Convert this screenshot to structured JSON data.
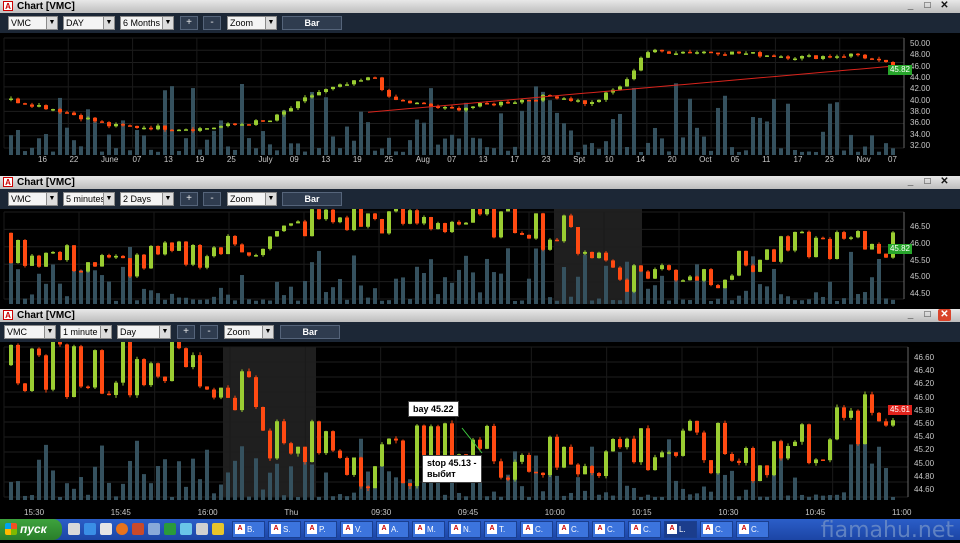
{
  "windows": [
    {
      "title": "Chart [VMC]",
      "symbol": "VMC",
      "interval": "DAY",
      "range": "6 Months",
      "tool": "Zoom",
      "plus": "+",
      "minus": "-",
      "bar_label": "Bar",
      "y_labels": [
        "50.00",
        "48.00",
        "46.00",
        "44.00",
        "42.00",
        "40.00",
        "38.00",
        "36.00",
        "34.00",
        "32.00"
      ],
      "x_labels": [
        "16",
        "22",
        "June",
        "07",
        "13",
        "19",
        "25",
        "July",
        "09",
        "13",
        "19",
        "25",
        "Aug",
        "07",
        "13",
        "17",
        "23",
        "Spt",
        "10",
        "14",
        "20",
        "Oct",
        "05",
        "11",
        "17",
        "23",
        "Nov",
        "07"
      ],
      "last_price": "45.82",
      "last_color": "#27a52b"
    },
    {
      "title": "Chart [VMC]",
      "symbol": "VMC",
      "interval": "5 minutes",
      "range": "2 Days",
      "tool": "Zoom",
      "plus": "+",
      "minus": "-",
      "bar_label": "Bar",
      "y_labels": [
        "46.50",
        "46.00",
        "45.50",
        "45.00",
        "44.50"
      ],
      "last_price": "45.82",
      "last_color": "#27a52b"
    },
    {
      "title": "Chart [VMC]",
      "symbol": "VMC",
      "interval": "1 minute",
      "range": "Day",
      "tool": "Zoom",
      "plus": "+",
      "minus": "-",
      "bar_label": "Bar",
      "y_labels": [
        "46.60",
        "46.40",
        "46.20",
        "46.00",
        "45.80",
        "45.60",
        "45.40",
        "45.20",
        "45.00",
        "44.80",
        "44.60"
      ],
      "x_labels": [
        "15:30",
        "15:45",
        "16:00",
        "Thu",
        "09:30",
        "09:45",
        "10:00",
        "10:15",
        "10:30",
        "10:45",
        "11:00"
      ],
      "last_price": "45.61",
      "last_color": "#e0231c",
      "annotations": {
        "buy": "bay 45.22",
        "stop_line1": "stop 45.13 -",
        "stop_line2": "выбит"
      }
    }
  ],
  "taskbar": {
    "start_label": "пуск",
    "tasks": [
      "B.",
      "S.",
      "P.",
      "V.",
      "A.",
      "M.",
      "N.",
      "T.",
      "C.",
      "C.",
      "C.",
      "C.",
      "L.",
      "C.",
      "C."
    ]
  },
  "watermark": "fiamahu.net",
  "colors": {
    "up": "#9acd32",
    "down": "#ff4a12",
    "volume": "#35515e",
    "sma": "#d8241c"
  }
}
